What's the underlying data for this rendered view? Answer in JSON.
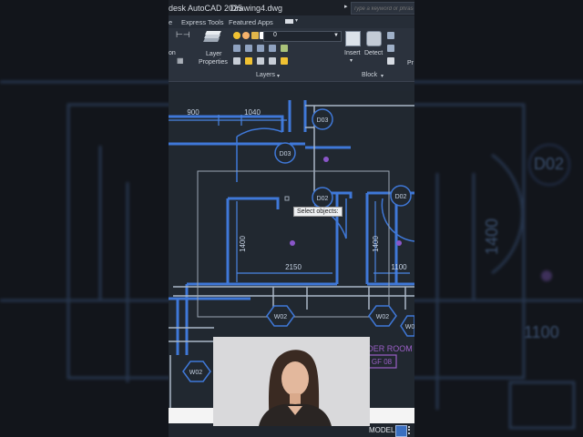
{
  "background": {
    "labels": [
      "D02",
      "1400",
      "1100"
    ]
  },
  "titlebar": {
    "app_name": "desk AutoCAD 2025",
    "file_name": "Drawing4.dwg",
    "search_placeholder": "Type a keyword or phrase"
  },
  "tabs": [
    "e",
    "Express Tools",
    "Featured Apps"
  ],
  "ribbon": {
    "layer_combo_value": "0",
    "layer_properties_label_1": "Layer",
    "layer_properties_label_2": "Properties",
    "layers_panel": "Layers",
    "insert_label": "Insert",
    "detect_label": "Detect",
    "block_panel": "Block",
    "left_cut_label": "on",
    "right_cut_label": "Pr"
  },
  "drawing": {
    "dims": [
      "900",
      "1040",
      "1400",
      "1400",
      "2150",
      "1100"
    ],
    "doors": [
      "D03",
      "D03",
      "D02",
      "D02"
    ],
    "windows": [
      "W02",
      "W02",
      "W02",
      "W0"
    ],
    "room_text": "DER ROOM",
    "room_code": "GF 08"
  },
  "tooltip": "Select objects:",
  "status": {
    "model": "MODEL"
  },
  "colors": {
    "wall": "#3f78d8",
    "wall_light": "#c2cdd9",
    "grip": "#8a56c9",
    "room_text": "#9b5fc7"
  }
}
